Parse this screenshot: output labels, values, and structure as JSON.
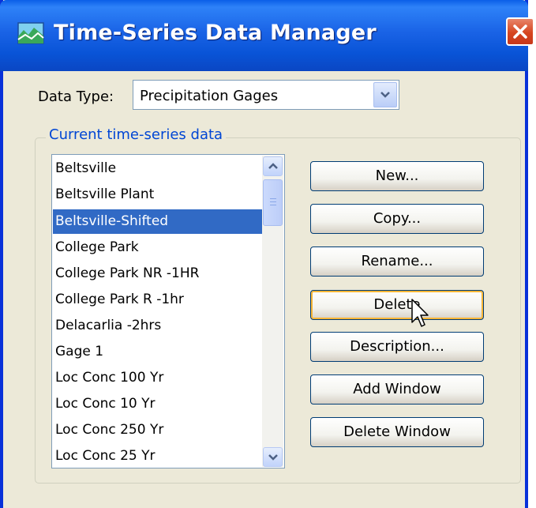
{
  "window": {
    "title": "Time-Series Data Manager"
  },
  "data_type": {
    "label": "Data Type:",
    "selected": "Precipitation Gages"
  },
  "group": {
    "legend": "Current time-series data"
  },
  "list": {
    "items": [
      {
        "label": "Beltsville"
      },
      {
        "label": "Beltsville Plant"
      },
      {
        "label": "Beltsville-Shifted",
        "selected": true
      },
      {
        "label": "College Park"
      },
      {
        "label": "College Park NR -1HR"
      },
      {
        "label": "College Park R -1hr"
      },
      {
        "label": "Delacarlia -2hrs"
      },
      {
        "label": "Gage 1"
      },
      {
        "label": "Loc Conc 100 Yr"
      },
      {
        "label": "Loc Conc 10 Yr"
      },
      {
        "label": "Loc Conc 250 Yr"
      },
      {
        "label": "Loc Conc 25 Yr"
      }
    ]
  },
  "buttons": {
    "new": "New...",
    "copy": "Copy...",
    "rename": "Rename...",
    "delete": "Delete",
    "description": "Description...",
    "add_window": "Add Window",
    "delete_window": "Delete Window"
  },
  "icons": {
    "title": "data-manager-icon",
    "close": "close-icon",
    "dropdown": "chevron-down-icon",
    "scroll_up": "arrow-up-icon",
    "scroll_down": "arrow-down-icon",
    "cursor": "mouse-pointer-icon"
  },
  "colors": {
    "titlebar": "#0a5ee8",
    "selection": "#316ac5",
    "group_legend": "#0046d5",
    "window_bg": "#ece9d8"
  }
}
